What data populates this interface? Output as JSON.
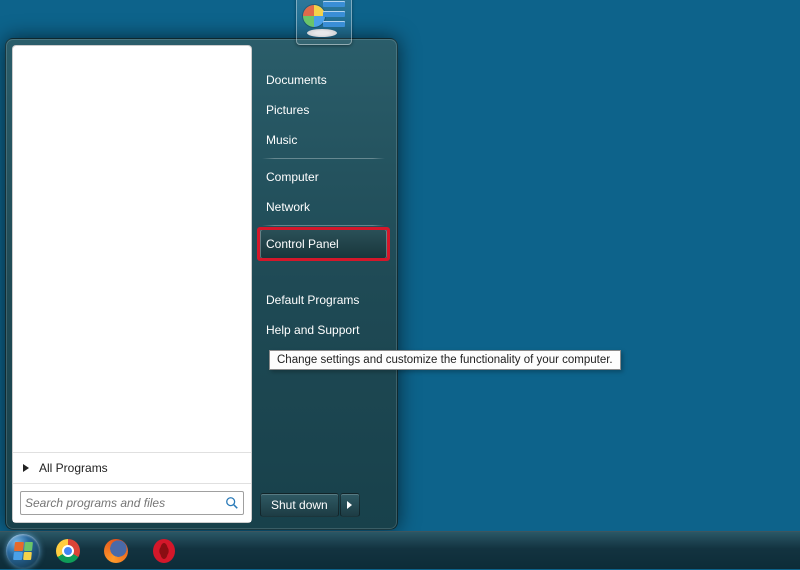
{
  "start_menu": {
    "all_programs_label": "All Programs",
    "search_placeholder": "Search programs and files",
    "right_items": [
      {
        "label": "Documents"
      },
      {
        "label": "Pictures"
      },
      {
        "label": "Music"
      },
      {
        "label": "Computer"
      },
      {
        "label": "Network"
      },
      {
        "label": "Control Panel",
        "highlighted": true,
        "tooltip": "Change settings and customize the functionality of your computer."
      },
      {
        "label": "Default Programs"
      },
      {
        "label": "Help and Support"
      }
    ],
    "shutdown_label": "Shut down"
  },
  "tooltip_text": "Change settings and customize the functionality of your computer.",
  "taskbar": {
    "pinned": [
      "chrome",
      "firefox",
      "opera"
    ]
  }
}
